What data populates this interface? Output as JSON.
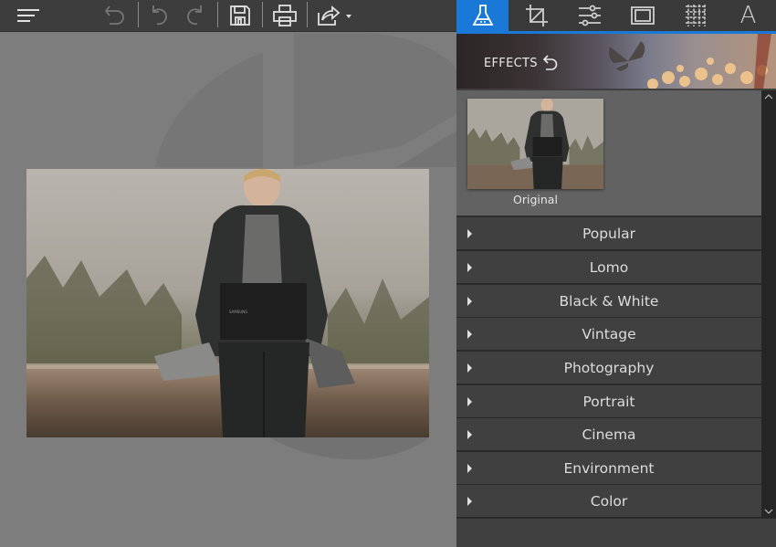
{
  "toolbar": {
    "icons": [
      {
        "name": "menu-icon"
      },
      {
        "name": "undo-all-icon"
      },
      {
        "name": "undo-icon"
      },
      {
        "name": "redo-icon"
      },
      {
        "name": "save-icon"
      },
      {
        "name": "print-icon"
      },
      {
        "name": "share-icon"
      }
    ]
  },
  "panel_tabs": [
    {
      "name": "effects-tab",
      "icon": "flask-icon",
      "active": true
    },
    {
      "name": "crop-tab",
      "icon": "crop-icon",
      "active": false
    },
    {
      "name": "adjust-tab",
      "icon": "sliders-icon",
      "active": false
    },
    {
      "name": "frames-tab",
      "icon": "frame-icon",
      "active": false
    },
    {
      "name": "texture-tab",
      "icon": "texture-icon",
      "active": false
    },
    {
      "name": "text-tab",
      "icon": "text-icon",
      "active": false,
      "glyph": "A"
    }
  ],
  "banner": {
    "title": "EFFECTS"
  },
  "original": {
    "label": "Original"
  },
  "categories": [
    {
      "label": "Popular"
    },
    {
      "label": "Lomo"
    },
    {
      "label": "Black & White"
    },
    {
      "label": "Vintage"
    },
    {
      "label": "Photography"
    },
    {
      "label": "Portrait"
    },
    {
      "label": "Cinema"
    },
    {
      "label": "Environment"
    },
    {
      "label": "Color"
    }
  ],
  "colors": {
    "accent": "#1a78d6",
    "panel": "#404040",
    "canvas": "#7d7d7d"
  }
}
